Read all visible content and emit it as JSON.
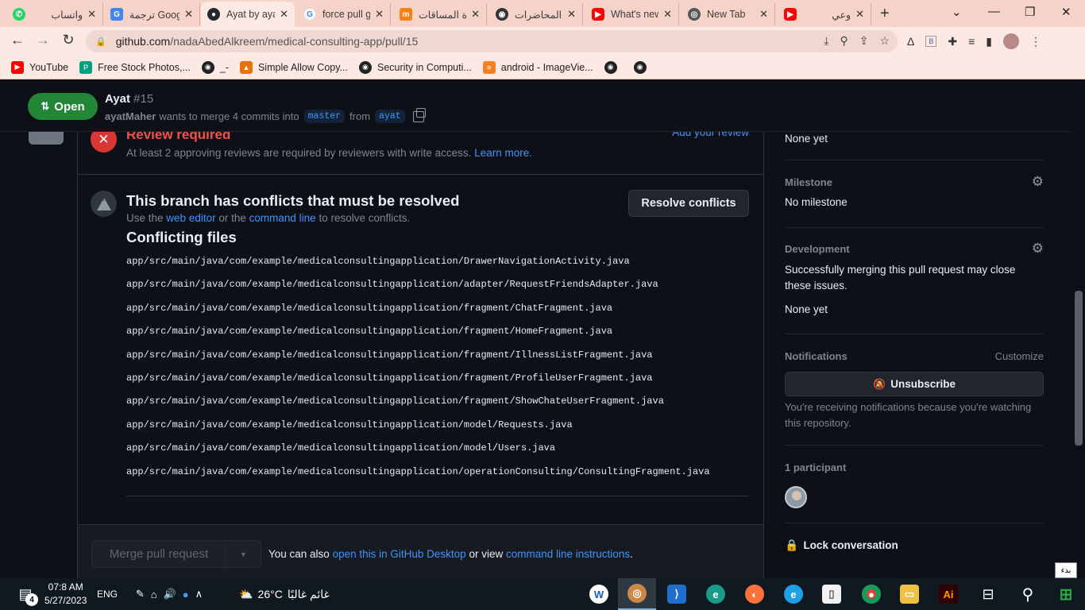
{
  "browser": {
    "tabs": [
      {
        "title": "واتساب",
        "icon": "whatsapp-icon",
        "color": "#25d366"
      },
      {
        "title": "ترجمة Google",
        "icon": "google-translate-icon",
        "color": "#4285f4"
      },
      {
        "title": "Ayat by ayatMaher",
        "icon": "github-icon",
        "color": "#24292f"
      },
      {
        "title": "force pull git",
        "icon": "google-icon",
        "color": "#4285f4"
      },
      {
        "title": "إدارة المساقات",
        "icon": "moodle-icon",
        "color": "#f98012"
      },
      {
        "title": "مواعيد المحاضرات",
        "icon": "globe-icon",
        "color": "#333333"
      },
      {
        "title": "What's new",
        "icon": "youtube-icon",
        "color": "#ff0000"
      },
      {
        "title": "New Tab",
        "icon": "chrome-icon",
        "color": "#555555"
      },
      {
        "title": "وعي",
        "icon": "youtube-icon",
        "color": "#ff0000"
      }
    ],
    "url_host": "github.com",
    "url_path": "/nadaAbedAlkreem/medical-consulting-app/pull/15",
    "bookmarks": [
      {
        "label": "YouTube",
        "icon": "youtube-icon",
        "color": "#ff0000"
      },
      {
        "label": "Free Stock Photos,...",
        "icon": "pexels-icon",
        "color": "#05a081"
      },
      {
        "label": "_-",
        "icon": "globe-icon",
        "color": "#222222"
      },
      {
        "label": "Simple Allow Copy...",
        "icon": "extension-icon",
        "color": "#e8710a"
      },
      {
        "label": "Security in Computi...",
        "icon": "globe-icon",
        "color": "#222222"
      },
      {
        "label": "android - ImageVie...",
        "icon": "stackoverflow-icon",
        "color": "#f48024"
      },
      {
        "label": "",
        "icon": "globe-icon",
        "color": "#222222"
      },
      {
        "label": "",
        "icon": "globe-icon",
        "color": "#222222"
      }
    ]
  },
  "pr": {
    "state": "Open",
    "title": "Ayat",
    "number": "#15",
    "author": "ayatMaher",
    "merge_text": "wants to merge 4 commits into",
    "base": "master",
    "from_text": "from",
    "head": "ayat"
  },
  "review": {
    "title": "Review required",
    "desc": "At least 2 approving reviews are required by reviewers with write access.",
    "learn_more": "Learn more.",
    "add_review": "Add your review"
  },
  "conflicts": {
    "title": "This branch has conflicts that must be resolved",
    "desc_prefix": "Use the",
    "web_editor": "web editor",
    "desc_mid": "or the",
    "command_line": "command line",
    "desc_suffix": "to resolve conflicts.",
    "resolve_label": "Resolve conflicts",
    "files_heading": "Conflicting files",
    "files": [
      "app/src/main/java/com/example/medicalconsultingapplication/DrawerNavigationActivity.java",
      "app/src/main/java/com/example/medicalconsultingapplication/adapter/RequestFriendsAdapter.java",
      "app/src/main/java/com/example/medicalconsultingapplication/fragment/ChatFragment.java",
      "app/src/main/java/com/example/medicalconsultingapplication/fragment/HomeFragment.java",
      "app/src/main/java/com/example/medicalconsultingapplication/fragment/IllnessListFragment.java",
      "app/src/main/java/com/example/medicalconsultingapplication/fragment/ProfileUserFragment.java",
      "app/src/main/java/com/example/medicalconsultingapplication/fragment/ShowChateUserFragment.java",
      "app/src/main/java/com/example/medicalconsultingapplication/model/Requests.java",
      "app/src/main/java/com/example/medicalconsultingapplication/model/Users.java",
      "app/src/main/java/com/example/medicalconsultingapplication/operationConsulting/ConsultingFragment.java"
    ]
  },
  "merge": {
    "button": "Merge pull request",
    "hint_prefix": "You can also",
    "desktop_link": "open this in GitHub Desktop",
    "hint_mid": "or view",
    "cli_link": "command line instructions",
    "hint_suffix": "."
  },
  "sidebar": {
    "linked_issues_value": "None yet",
    "milestone_head": "Milestone",
    "milestone_value": "No milestone",
    "development_head": "Development",
    "development_desc": "Successfully merging this pull request may close these issues.",
    "development_value": "None yet",
    "notifications_head": "Notifications",
    "customize": "Customize",
    "unsubscribe": "Unsubscribe",
    "notif_desc": "You're receiving notifications because you're watching this repository.",
    "participants": "1 participant",
    "lock": "Lock conversation"
  },
  "tooltip": "بدء",
  "taskbar": {
    "time": "07:8 AM",
    "date": "5/27/2023",
    "notif_count": "4",
    "lang": "ENG",
    "temp": "26°C",
    "weather": "غائم غالبًا"
  }
}
